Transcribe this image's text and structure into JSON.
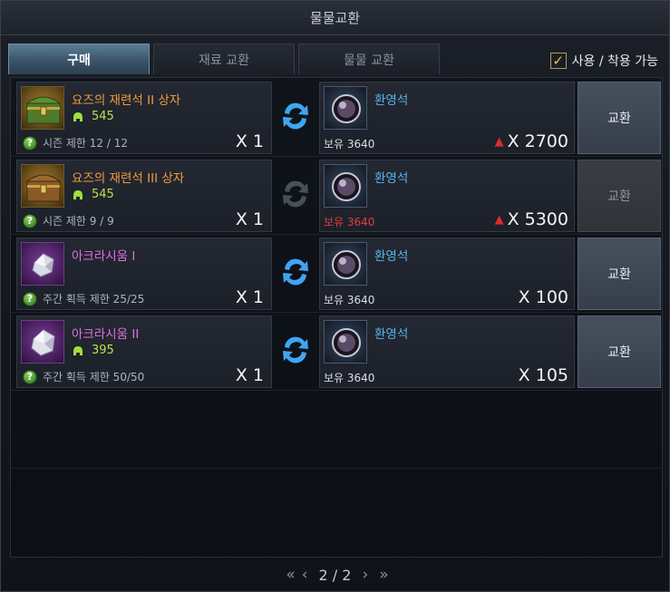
{
  "window": {
    "title": "물물교환"
  },
  "tabs": [
    {
      "label": "구매",
      "active": true
    },
    {
      "label": "재료 교환",
      "active": false
    },
    {
      "label": "물물 교환",
      "active": false
    }
  ],
  "filter": {
    "label": "사용 / 착용 가능",
    "checked": true
  },
  "rows": [
    {
      "item": {
        "name": "요즈의 재련석 II 상자",
        "name_color": "orange",
        "icon": "treasure-chest-green-icon",
        "level": "545"
      },
      "limit": "시즌 제한 12 / 12",
      "qty": "X 1",
      "cost": {
        "name": "환영석",
        "icon": "phantom-orb-icon",
        "own": "보유 3640",
        "own_insufficient": false,
        "amount": "X 2700",
        "increased": true
      },
      "button": {
        "label": "교환",
        "enabled": true
      }
    },
    {
      "item": {
        "name": "요즈의 재련석 III 상자",
        "name_color": "orange",
        "icon": "treasure-chest-bronze-icon",
        "level": "545"
      },
      "limit": "시즌 제한 9 / 9",
      "qty": "X 1",
      "cost": {
        "name": "환영석",
        "icon": "phantom-orb-icon",
        "own": "보유 3640",
        "own_insufficient": true,
        "amount": "X 5300",
        "increased": true
      },
      "button": {
        "label": "교환",
        "enabled": false
      }
    },
    {
      "item": {
        "name": "아크라시움 I",
        "name_color": "pink",
        "icon": "crystal-shard-icon",
        "level": ""
      },
      "limit": "주간 획득 제한 25/25",
      "qty": "X 1",
      "cost": {
        "name": "환영석",
        "icon": "phantom-orb-icon",
        "own": "보유 3640",
        "own_insufficient": false,
        "amount": "X 100",
        "increased": false
      },
      "button": {
        "label": "교환",
        "enabled": true
      }
    },
    {
      "item": {
        "name": "아크라시움 II",
        "name_color": "pink",
        "icon": "crystal-shard-icon",
        "level": "395"
      },
      "limit": "주간 획득 제한 50/50",
      "qty": "X 1",
      "cost": {
        "name": "환영석",
        "icon": "phantom-orb-icon",
        "own": "보유 3640",
        "own_insufficient": false,
        "amount": "X 105",
        "increased": false
      },
      "button": {
        "label": "교환",
        "enabled": true
      }
    }
  ],
  "pagination": {
    "label": "2 / 2"
  },
  "colors": {
    "accent": "#3a5468",
    "item_orange": "#f29a3a",
    "item_pink": "#e36fe0",
    "currency_blue": "#5ab5f0",
    "insufficient_red": "#e23b3b",
    "level_green": "#b8e04a"
  }
}
